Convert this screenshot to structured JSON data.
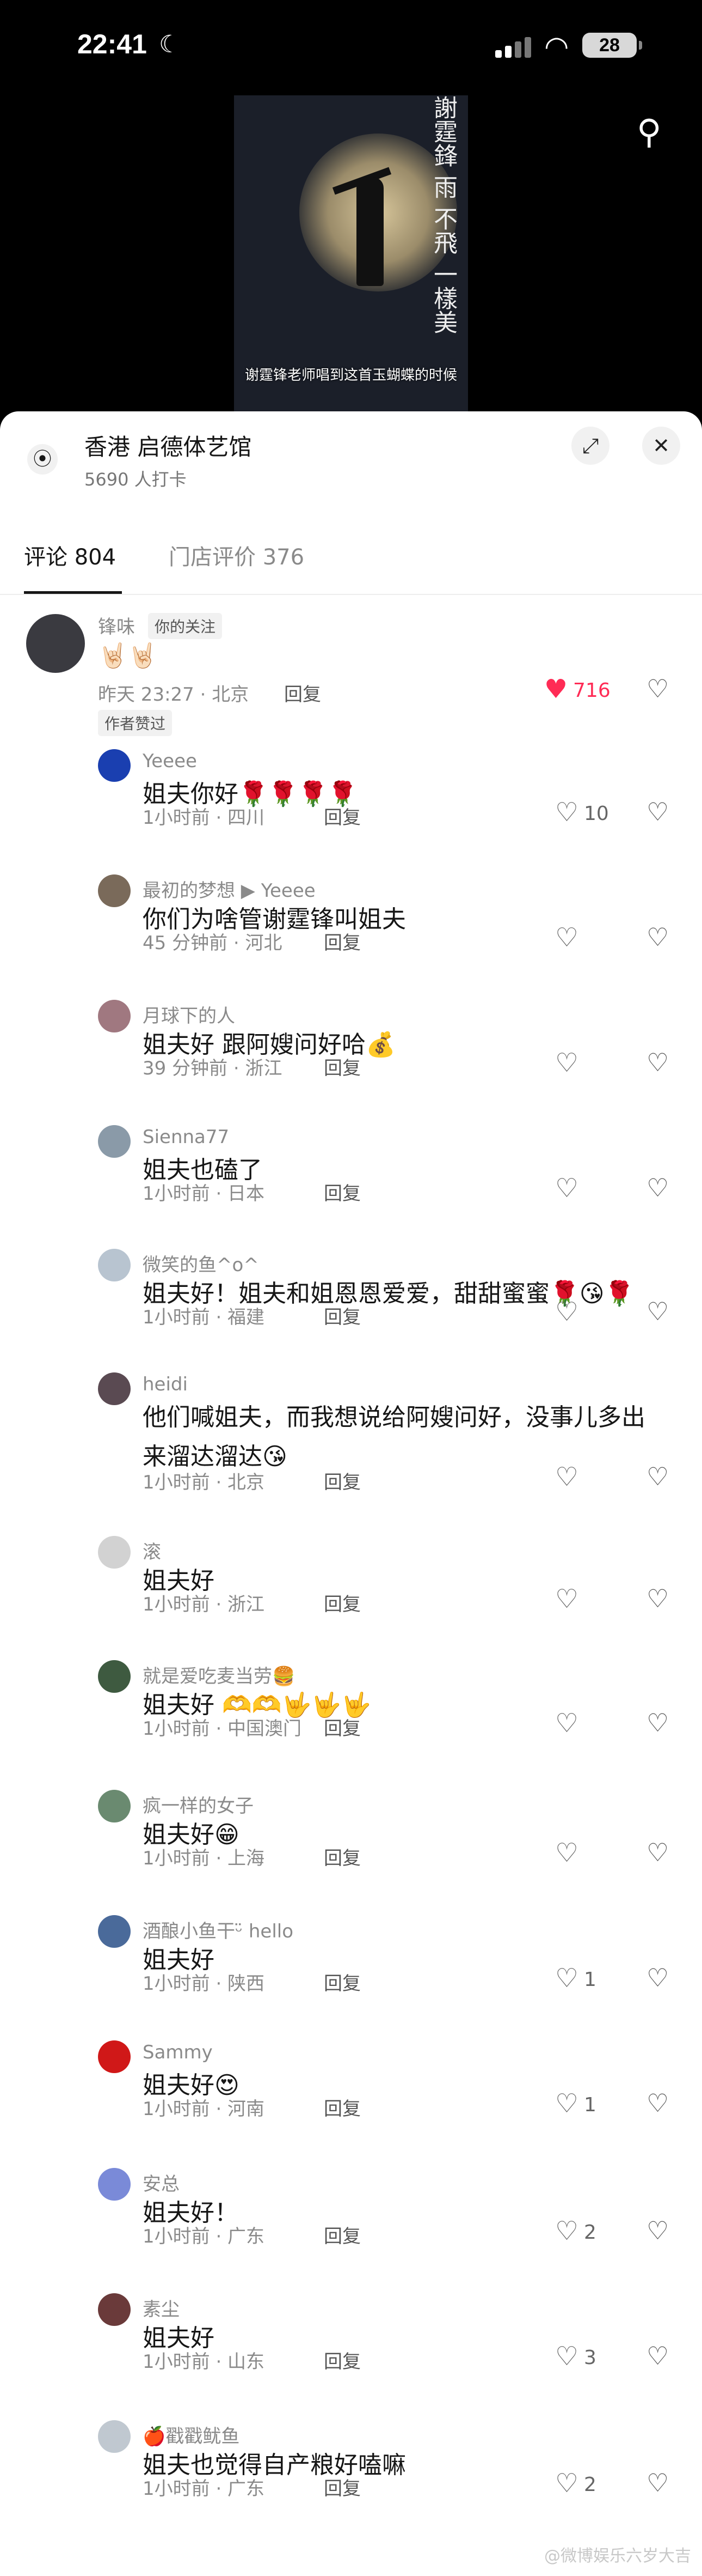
{
  "status": {
    "time": "22:41",
    "battery": "28"
  },
  "video": {
    "overlay_text": "謝霆鋒 雨 不飛 一樣美",
    "caption": "谢霆锋老师唱到这首玉蝴蝶的时候"
  },
  "location": {
    "name": "香港  启德体艺馆",
    "checkins": "5690 人打卡"
  },
  "tabs": [
    {
      "label": "评论 804"
    },
    {
      "label": "门店评价 376"
    }
  ],
  "top_comment": {
    "user": "锋味",
    "badge": "你的关注",
    "text": "🤘🏻🤘🏻",
    "meta": "昨天 23:27 · 北京",
    "reply": "回复",
    "likes": "716",
    "author_tag": "作者赞过"
  },
  "replies": [
    {
      "user": "Yeeee",
      "text": "姐夫你好🌹🌹🌹🌹",
      "meta": "1小时前 · 四川",
      "reply": "回复",
      "likes": "10",
      "avatar_color": "#1a3fb0"
    },
    {
      "user": "最初的梦想 ▶ Yeeee",
      "text": "你们为啥管谢霆锋叫姐夫",
      "meta": "45 分钟前 · 河北",
      "reply": "回复",
      "likes": "",
      "avatar_color": "#7a6a5a"
    },
    {
      "user": "月球下的人",
      "text": "姐夫好 跟阿嫂问好哈💰",
      "meta": "39 分钟前 · 浙江",
      "reply": "回复",
      "likes": "",
      "avatar_color": "#a07880"
    },
    {
      "user": "Sienna77",
      "text": "姐夫也磕了",
      "meta": "1小时前 · 日本",
      "reply": "回复",
      "likes": "",
      "avatar_color": "#8a9aa8"
    },
    {
      "user": "微笑的鱼^o^",
      "text": "姐夫好！姐夫和姐恩恩爱爱，甜甜蜜蜜🌹😘🌹",
      "meta": "1小时前 · 福建",
      "reply": "回复",
      "likes": "",
      "avatar_color": "#b8c4d0"
    },
    {
      "user": "heidi",
      "text": "他们喊姐夫，而我想说给阿嫂问好，没事儿多出",
      "text2": "来溜达溜达😘",
      "meta": "1小时前 · 北京",
      "reply": "回复",
      "likes": "",
      "avatar_color": "#5a4a52"
    },
    {
      "user": "滚",
      "text": "姐夫好",
      "meta": "1小时前 · 浙江",
      "reply": "回复",
      "likes": "",
      "avatar_color": "#d2d2d2"
    },
    {
      "user": "就是爱吃麦当劳🍔",
      "text": "姐夫好 🫶🫶🤟🤟🤟",
      "meta": "1小时前 · 中国澳门",
      "reply": "回复",
      "likes": "",
      "avatar_color": "#3e5a40"
    },
    {
      "user": "疯一样的女子",
      "text": "姐夫好😁",
      "meta": "1小时前 · 上海",
      "reply": "回复",
      "likes": "",
      "avatar_color": "#6a8a70"
    },
    {
      "user": "酒酿小鱼干ᵕ̈ hello",
      "text": "姐夫好",
      "meta": "1小时前 · 陕西",
      "reply": "回复",
      "likes": "1",
      "avatar_color": "#4a6a9a"
    },
    {
      "user": "Sammy",
      "text": "姐夫好😍",
      "meta": "1小时前 · 河南",
      "reply": "回复",
      "likes": "1",
      "avatar_color": "#d01818"
    },
    {
      "user": "安总",
      "text": "姐夫好！",
      "meta": "1小时前 · 广东",
      "reply": "回复",
      "likes": "2",
      "avatar_color": "#7a8ad8"
    },
    {
      "user": "素尘",
      "text": "姐夫好",
      "meta": "1小时前 · 山东",
      "reply": "回复",
      "likes": "3",
      "avatar_color": "#6a3a3a"
    },
    {
      "user": "🍎戳戳鱿鱼",
      "text": "姐夫也觉得自产粮好嗑嘛",
      "meta": "1小时前 · 广东",
      "reply": "回复",
      "likes": "2",
      "avatar_color": "#c0c8d0"
    }
  ],
  "watermark": "@微博娱乐六岁大吉"
}
